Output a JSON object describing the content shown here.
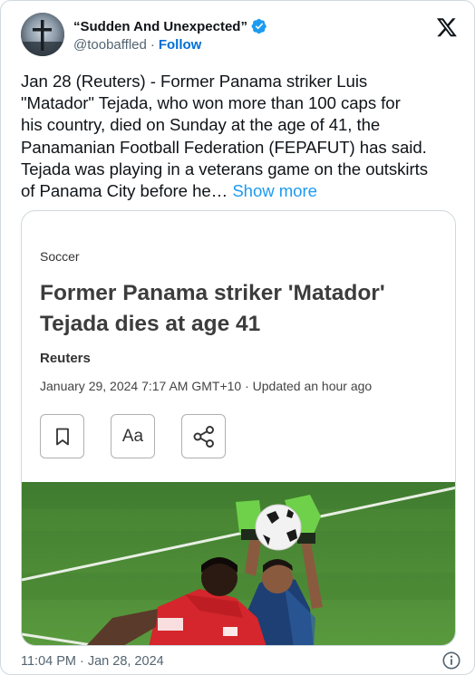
{
  "author": {
    "display_name": "“Sudden And Unexpected”",
    "handle": "@toobaffled",
    "separator": "·",
    "follow_label": "Follow",
    "verified": true
  },
  "icons": {
    "verified": "verified-badge-icon",
    "platform": "x-logo-icon",
    "bookmark": "bookmark-icon",
    "text_size": "text-size-icon",
    "share": "share-icon",
    "info": "info-icon"
  },
  "colors": {
    "link_blue": "#1d9bf0",
    "follow_blue": "#006fd6",
    "secondary_text": "#536471",
    "border": "#cfd9de"
  },
  "tweet": {
    "lines": [
      "Jan 28 (Reuters) - Former Panama striker Luis",
      "\"Matador\" Tejada, who won more than 100 caps for",
      "his country, died on Sunday at the age of 41, the",
      "Panamanian Football Federation (FEPAFUT) has said.",
      "Tejada was playing in a veterans game on the outskirts",
      "of Panama City before he… "
    ],
    "show_more_label": "Show more"
  },
  "card": {
    "section": "Soccer",
    "title": "Former Panama striker 'Matador' Tejada dies at age 41",
    "source": "Reuters",
    "date": "January 29, 2024 7:17 AM GMT+10 · Updated an hour ago",
    "text_size_label": "Aa"
  },
  "meta": {
    "time": "11:04 PM",
    "separator": "·",
    "date": "Jan 28, 2024"
  }
}
